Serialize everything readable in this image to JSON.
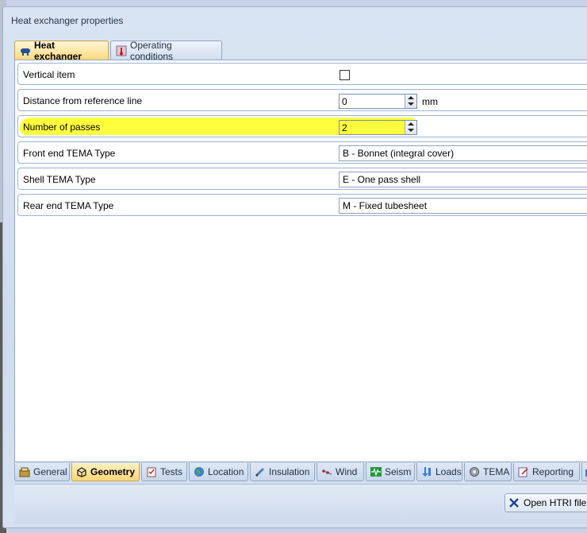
{
  "window": {
    "title": "Heat exchanger properties"
  },
  "top_tabs": [
    {
      "label": "Heat exchanger",
      "icon": "heat-exchanger-icon",
      "active": true
    },
    {
      "label": "Operating conditions",
      "icon": "thermometer-icon",
      "active": false
    }
  ],
  "properties": {
    "vertical_item": {
      "label": "Vertical item",
      "checked": false
    },
    "distance": {
      "label": "Distance from reference line",
      "value": "0",
      "unit": "mm"
    },
    "passes": {
      "label": "Number of passes",
      "value": "2"
    },
    "front_end": {
      "label": "Front end TEMA Type",
      "value": "B - Bonnet (integral cover)"
    },
    "shell": {
      "label": "Shell TEMA Type",
      "value": "E - One pass shell"
    },
    "rear_end": {
      "label": "Rear end TEMA Type",
      "value": "M - Fixed tubesheet"
    }
  },
  "bottom_tabs": [
    {
      "label": "General",
      "icon": "general-icon"
    },
    {
      "label": "Geometry",
      "icon": "geometry-icon",
      "active": true
    },
    {
      "label": "Tests",
      "icon": "tests-icon"
    },
    {
      "label": "Location",
      "icon": "globe-icon"
    },
    {
      "label": "Insulation",
      "icon": "insulation-icon"
    },
    {
      "label": "Wind",
      "icon": "wind-icon"
    },
    {
      "label": "Seism",
      "icon": "seism-icon"
    },
    {
      "label": "Loads",
      "icon": "loads-icon"
    },
    {
      "label": "TEMA",
      "icon": "tema-icon"
    },
    {
      "label": "Reporting",
      "icon": "reporting-icon"
    }
  ],
  "footer": {
    "open_htri_label": "Open HTRI file"
  },
  "colors": {
    "highlight": "#ffff33",
    "active_tab": "#ffd97a",
    "border": "#9ab3d2"
  }
}
